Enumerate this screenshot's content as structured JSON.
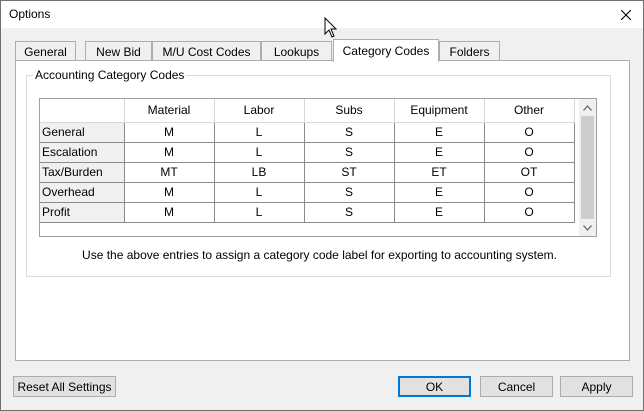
{
  "window": {
    "title": "Options"
  },
  "tabs": [
    {
      "label": "General"
    },
    {
      "label": "New Bid"
    },
    {
      "label": "M/U Cost Codes"
    },
    {
      "label": "Lookups"
    },
    {
      "label": "Category Codes",
      "active": true
    },
    {
      "label": "Folders"
    }
  ],
  "group": {
    "label": "Accounting Category Codes",
    "columns": [
      "Material",
      "Labor",
      "Subs",
      "Equipment",
      "Other"
    ],
    "rows": [
      {
        "label": "General",
        "values": [
          "M",
          "L",
          "S",
          "E",
          "O"
        ]
      },
      {
        "label": "Escalation",
        "values": [
          "M",
          "L",
          "S",
          "E",
          "O"
        ]
      },
      {
        "label": "Tax/Burden",
        "values": [
          "MT",
          "LB",
          "ST",
          "ET",
          "OT"
        ]
      },
      {
        "label": "Overhead",
        "values": [
          "M",
          "L",
          "S",
          "E",
          "O"
        ]
      },
      {
        "label": "Profit",
        "values": [
          "M",
          "L",
          "S",
          "E",
          "O"
        ]
      }
    ],
    "help_text": "Use the above entries to assign a category code label  for exporting to accounting system."
  },
  "buttons": {
    "reset": "Reset All Settings",
    "ok": "OK",
    "cancel": "Cancel",
    "apply": "Apply"
  },
  "icons": {
    "close": "close-icon",
    "scroll_up": "chevron-up-icon",
    "scroll_down": "chevron-down-icon",
    "cursor": "mouse-pointer-icon"
  },
  "colors": {
    "default_button_border": "#0078d7",
    "window_bg": "#f0f0f0",
    "panel_bg": "#ffffff"
  }
}
